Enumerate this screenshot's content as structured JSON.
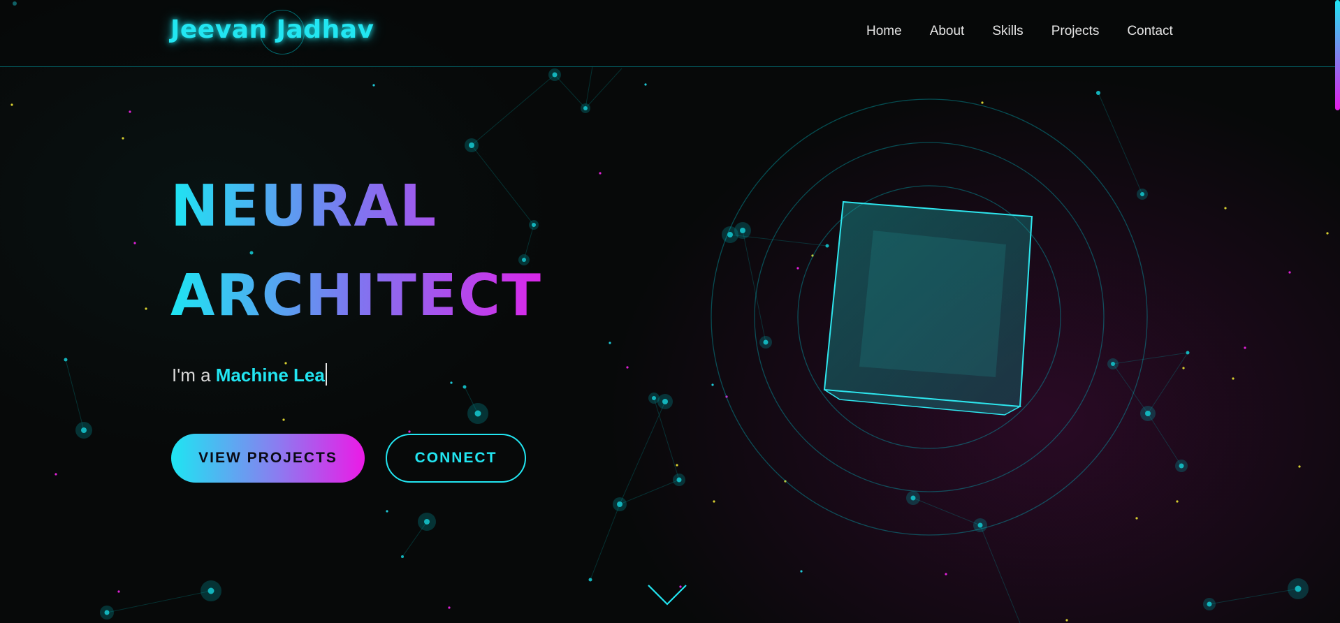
{
  "brand": {
    "name": "Jeevan Jadhav",
    "accent_cyan": "#1ee5f2",
    "accent_magenta": "#e41ee8",
    "accent_purple": "#8b7cf0"
  },
  "nav": {
    "items": [
      {
        "label": "Home"
      },
      {
        "label": "About"
      },
      {
        "label": "Skills"
      },
      {
        "label": "Projects"
      },
      {
        "label": "Contact"
      }
    ]
  },
  "hero": {
    "title_line1": "NEURAL",
    "title_line2": "ARCHITECT",
    "typed_prefix": "I'm a ",
    "typed_text": "Machine Lea",
    "primary_button": "VIEW PROJECTS",
    "secondary_button": "CONNECT"
  },
  "icons": {
    "scroll_down": "chevron-down-icon",
    "hero_visual": "cube-icon"
  }
}
